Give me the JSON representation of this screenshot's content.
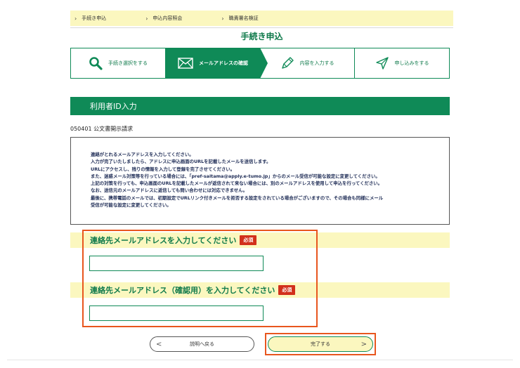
{
  "breadcrumb": {
    "items": [
      "手続き申込",
      "申込内容照会",
      "職責署名検証"
    ]
  },
  "page_title": "手続き申込",
  "steps": [
    {
      "label": "手続き選択をする",
      "icon": "search-icon",
      "active": false
    },
    {
      "label": "メールアドレスの確認",
      "icon": "envelope-icon",
      "active": true
    },
    {
      "label": "内容を入力する",
      "icon": "pencil-icon",
      "active": false
    },
    {
      "label": "申し込みをする",
      "icon": "send-icon",
      "active": false
    }
  ],
  "section_title": "利用者ID入力",
  "form_code": "050401 公文書開示請求",
  "notice_lines": [
    "連絡がとれるメールアドレスを入力してください。",
    "入力が完了いたしましたら、アドレスに申込画面のURLを記載したメールを送信します。",
    "URLにアクセスし、残りの情報を入力して登録を完了させてください。",
    "また、迷惑メール対策等を行っている場合には、「pref-saitama@apply.e-tumo.jp」からのメール受信が可能な設定に変更してください。",
    "上記の対策を行っても、申込画面のURLを記載したメールが返信されて来ない場合には、別のメールアドレスを使用して申込を行ってください。",
    "なお、送信元のメールアドレスに返信しても問い合わせには対応できません。",
    "最後に、携帯電話のメールでは、初期設定でURLリンク付きメールを拒否する設定をされている場合がございますので、その場合も同様にメール",
    "受信が可能な設定に変更してください。"
  ],
  "fields": {
    "email": {
      "label": "連絡先メールアドレスを入力してください",
      "required_badge": "必須",
      "value": ""
    },
    "email_confirm": {
      "label": "連絡先メールアドレス（確認用）を入力してください",
      "required_badge": "必須",
      "value": ""
    }
  },
  "buttons": {
    "back": "説明へ戻る",
    "submit": "完了する"
  },
  "colors": {
    "primary": "#0f8a57",
    "band": "#fbf7bf",
    "required": "#d2301b",
    "highlight": "#e8561e"
  }
}
